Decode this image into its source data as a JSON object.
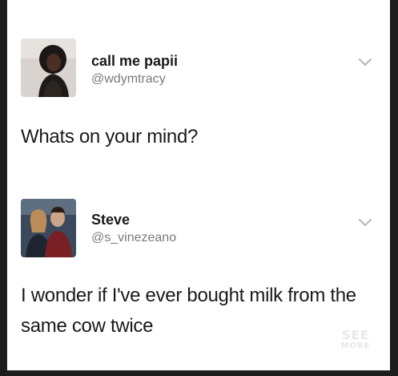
{
  "tweets": [
    {
      "display_name": "call me papii",
      "handle": "@wdymtracy",
      "text": "Whats on your mind?",
      "avatar_icon": "profile-photo",
      "menu_icon": "chevron-down-icon"
    },
    {
      "display_name": "Steve",
      "handle": "@s_vinezeano",
      "text": "I wonder if I've ever bought milk from the same cow twice",
      "avatar_icon": "profile-photo",
      "menu_icon": "chevron-down-icon"
    }
  ],
  "watermark": {
    "line1": "SEE",
    "line2": "MORE"
  },
  "colors": {
    "background": "#ffffff",
    "outer": "#1c1c1c",
    "name": "#1a1a1a",
    "handle": "#7a7a7a",
    "chevron": "#b5b5b5"
  }
}
